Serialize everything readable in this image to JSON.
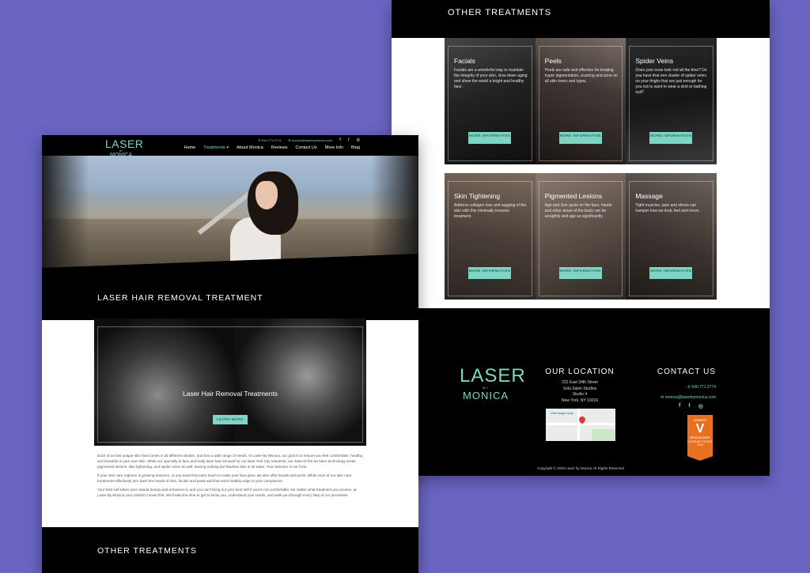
{
  "colors": {
    "background": "#6a65c3",
    "accent": "#7fd4c4",
    "black": "#000000",
    "badge": "#e8701f"
  },
  "back_page": {
    "other_title": "OTHER TREATMENTS",
    "treatments": [
      {
        "name": "Facials",
        "desc": "Facials are a wonderful way to maintain the integrity of your skin, slow down aging and show the world a bright and healthy face.",
        "button": "MORE INFORMATION"
      },
      {
        "name": "Peels",
        "desc": "Peels are safe and effective for treating hyper pigmentation, scarring and acne on all skin tones and types.",
        "button": "MORE INFORMATION"
      },
      {
        "name": "Spider Veins",
        "desc": "Does your nose look red all the time? Do you have that one cluster of spider veins on your thighs that are just enough for you not to want to wear a skirt or bathing suit?",
        "button": "MORE INFORMATION"
      },
      {
        "name": "Skin Tightening",
        "desc": "Address collagen loss and sagging of the skin with this minimally invasive treatment.",
        "button": "MORE INFORMATION"
      },
      {
        "name": "Pigmented Lesions",
        "desc": "Age and Sun spots on the face, hands and other areas of the body can be unsightly and age us significantly.",
        "button": "MORE INFORMATION"
      },
      {
        "name": "Massage",
        "desc": "Tight muscles, pain and stress can hamper how we look, feel and move.",
        "button": "MORE INFORMATION"
      }
    ],
    "footer": {
      "logo": {
        "line1": "LASER",
        "line2": "BY",
        "line3": "MONICA"
      },
      "location_title": "OUR LOCATION",
      "address": [
        "222 East 34th Street",
        "Sola Salon Studios",
        "Studio 4",
        "New York, NY 10016"
      ],
      "map_label": "View larger map",
      "contact_title": "CONTACT US",
      "phone": "646.771.2774",
      "email": "monica@laserbymonica.com",
      "social": [
        "facebook-icon",
        "twitter-icon",
        "instagram-icon"
      ],
      "badge": {
        "top": "WINNER",
        "mid": "V",
        "bottom": "WEDDINGWIRE\nCOUPLES' CHOICE\n2019"
      },
      "copyright": "Copyright © 2020 Laser by Monica All Rights Reserved"
    }
  },
  "front_page": {
    "logo": {
      "line1": "LASER",
      "line2": "BY",
      "line3": "MONICA"
    },
    "topline": {
      "phone": "646.771.2774",
      "email": "monica@laserbymonica.com"
    },
    "menu": [
      "Home",
      "Treatments ▾",
      "About Monica",
      "Reviews",
      "Contact Us",
      "More Info",
      "Blog"
    ],
    "active_menu_index": 1,
    "hero_title": "LASER HAIR REMOVAL TREATMENT",
    "feature": {
      "title": "Laser Hair Removal Treatments",
      "button": "LEARN MORE"
    },
    "paragraphs": [
      "Each of us has unique skin that comes in all different shades, and has a wide range of needs. At Laser By Monica, our goal is to ensure you feel comfortable, healthy, and beautiful in your own skin. While our specialty is face and body laser hair removal for our New York City residents, our state-of-the-art laser technology treats pigmented lesions, skin tightening, and spider veins as well, leaving nothing but flawless skin in its wake. Your skincare is our forte.",
      "If your skin care regimen is growing tiresome, or you need that extra touch to make your face glow, we also offer facials and peels. While each of our skin care treatments effectively turn back the hands of time, facials and peels add that extra healthy edge to your complexion.",
      "Your best self takes your natural beauty and enhances it, and you can't bring out your best self if you're not comfortable. No matter what treatment you receive, at Laser By Monica your comfort comes first. We'll take the time to get to know you, understand your needs, and walk you through every step of our processes."
    ],
    "other_title": "OTHER TREATMENTS"
  }
}
